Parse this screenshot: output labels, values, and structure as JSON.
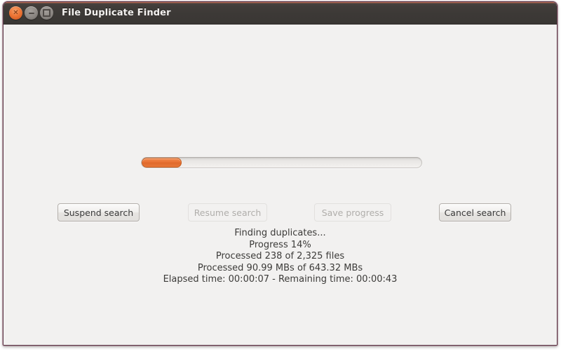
{
  "window": {
    "title": "File Duplicate Finder",
    "controls": [
      {
        "name": "close",
        "icon": "close-icon",
        "glyph": "✕"
      },
      {
        "name": "minimize",
        "icon": "minimize-icon",
        "glyph": ""
      },
      {
        "name": "maximize",
        "icon": "maximize-icon",
        "glyph": ""
      }
    ]
  },
  "progress": {
    "percent": 14,
    "percent_label": "14%",
    "fill_width_css": "14.4%",
    "accent_color": "#ea7435",
    "track_color": "#eae8e6"
  },
  "buttons": {
    "suspend": {
      "label": "Suspend search",
      "enabled": true
    },
    "resume": {
      "label": "Resume search",
      "enabled": false
    },
    "save": {
      "label": "Save progress",
      "enabled": false
    },
    "cancel": {
      "label": "Cancel search",
      "enabled": true
    }
  },
  "status": {
    "line1": "Finding duplicates...",
    "line2": "Progress 14%",
    "line3": "Processed 238 of 2,325 files",
    "line4": "Processed 90.99 MBs of 643.32 MBs",
    "line5": "Elapsed time: 00:00:07 - Remaining time: 00:00:43"
  }
}
